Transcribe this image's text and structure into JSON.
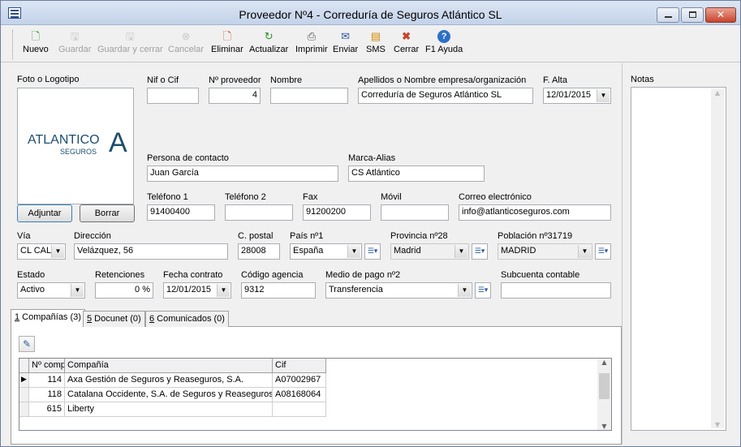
{
  "window": {
    "title": "Proveedor Nº4 - Correduría de Seguros Atlántico SL"
  },
  "toolbar": {
    "nuevo": "Nuevo",
    "guardar": "Guardar",
    "guardar_cerrar": "Guardar y cerrar",
    "cancelar": "Cancelar",
    "eliminar": "Eliminar",
    "actualizar": "Actualizar",
    "imprimir": "Imprimir",
    "enviar": "Enviar",
    "sms": "SMS",
    "cerrar": "Cerrar",
    "ayuda": "F1 Ayuda"
  },
  "logo": {
    "label": "Foto o Logotipo",
    "brand": "ATLANTICO",
    "sub": "SEGUROS",
    "mark": "A",
    "adjuntar": "Adjuntar",
    "borrar": "Borrar"
  },
  "form": {
    "nif_label": "Nif o Cif",
    "nif_value": "",
    "nprov_label": "Nº proveedor",
    "nprov_value": "4",
    "nombre_label": "Nombre",
    "nombre_value": "",
    "apellidos_label": "Apellidos o Nombre empresa/organización",
    "apellidos_value": "Correduría de Seguros Atlántico SL",
    "falta_label": "F. Alta",
    "falta_value": "12/01/2015",
    "contacto_label": "Persona de contacto",
    "contacto_value": "Juan García",
    "marca_label": "Marca-Alias",
    "marca_value": "CS Atlántico",
    "tel1_label": "Teléfono 1",
    "tel1_value": "91400400",
    "tel2_label": "Teléfono 2",
    "tel2_value": "",
    "fax_label": "Fax",
    "fax_value": "91200200",
    "movil_label": "Móvil",
    "movil_value": "",
    "correo_label": "Correo electrónico",
    "correo_value": "info@atlanticoseguros.com",
    "via_label": "Vía",
    "via_value": "CL CAL",
    "direccion_label": "Dirección",
    "direccion_value": "Velázquez, 56",
    "cp_label": "C. postal",
    "cp_value": "28008",
    "pais_label": "País nº1",
    "pais_value": "España",
    "provincia_label": "Provincia nº28",
    "provincia_value": "Madrid",
    "poblacion_label": "Población nº31719",
    "poblacion_value": "MADRID",
    "estado_label": "Estado",
    "estado_value": "Activo",
    "retenciones_label": "Retenciones",
    "retenciones_value": "0 %",
    "fcontrato_label": "Fecha contrato",
    "fcontrato_value": "12/01/2015",
    "codagencia_label": "Código agencia",
    "codagencia_value": "9312",
    "mediopago_label": "Medio de pago nº2",
    "mediopago_value": "Transferencia",
    "subcuenta_label": "Subcuenta contable",
    "subcuenta_value": ""
  },
  "notes": {
    "label": "Notas"
  },
  "tabs": [
    {
      "key": "1",
      "label": " Compañías (3)"
    },
    {
      "key": "5",
      "label": " Docunet (0)"
    },
    {
      "key": "6",
      "label": " Comunicados (0)"
    }
  ],
  "grid": {
    "headers": [
      "Nº comp",
      "Compañía",
      "Cif"
    ],
    "rows": [
      [
        "114",
        "Axa Gestión de Seguros y Reaseguros, S.A.",
        "A07002967"
      ],
      [
        "118",
        "Catalana Occidente, S.A. de Seguros y Reaseguros",
        "A08168064"
      ],
      [
        "615",
        "Liberty",
        ""
      ]
    ]
  },
  "colors": {
    "accent": "#2c5aa0",
    "close": "#c8442c"
  }
}
